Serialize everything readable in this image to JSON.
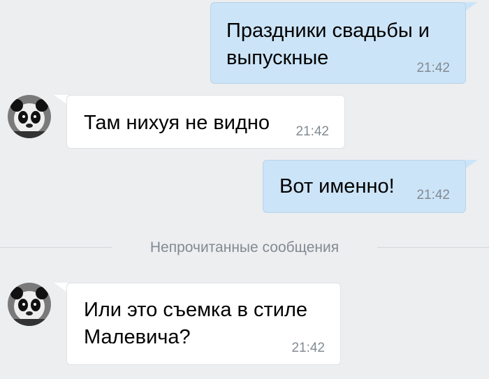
{
  "messages": [
    {
      "direction": "outgoing",
      "text": "Праздники свадьбы и\nвыпускные",
      "time": "21:42"
    },
    {
      "direction": "incoming",
      "text": "Там нихуя не видно",
      "time": "21:42",
      "avatar_icon": "panda-avatar"
    },
    {
      "direction": "outgoing",
      "text": "Вот именно!",
      "time": "21:42"
    },
    {
      "direction": "incoming",
      "text": "Или это съемка в стиле\nМалевича?",
      "time": "21:42",
      "avatar_icon": "panda-avatar"
    }
  ],
  "unread_divider": {
    "label": "Непрочитанные сообщения"
  },
  "colors": {
    "background": "#edeef0",
    "outgoing_bubble": "#cce4f7",
    "incoming_bubble": "#ffffff",
    "timestamp": "#828a93"
  }
}
